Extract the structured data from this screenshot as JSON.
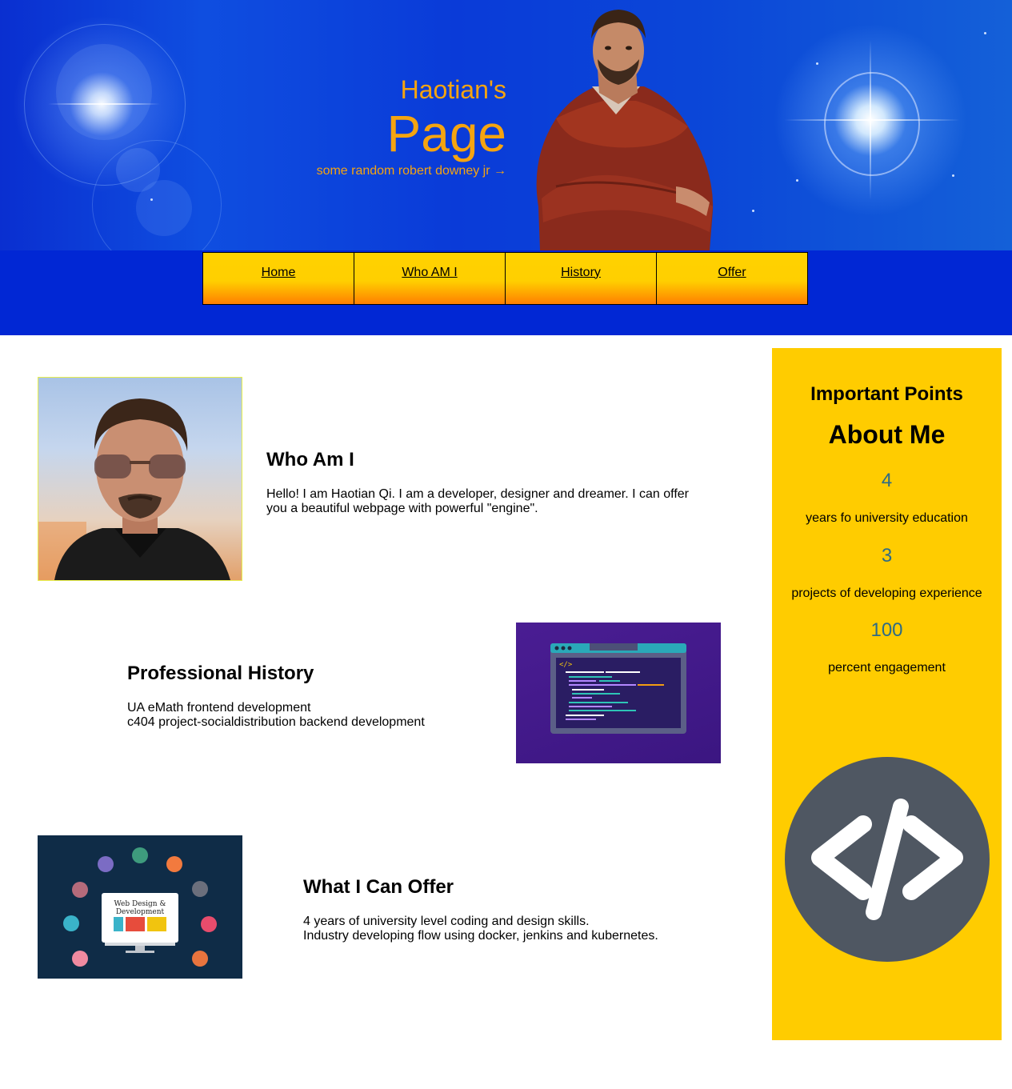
{
  "header": {
    "title_small": "Haotian's",
    "title_big": "Page",
    "subtitle": "some random robert downey jr →",
    "title_color": "#f5a410",
    "background": "#0127d4"
  },
  "nav": {
    "items": [
      {
        "label": "Home"
      },
      {
        "label": "Who AM I"
      },
      {
        "label": "History"
      },
      {
        "label": "Offer"
      }
    ]
  },
  "sections": {
    "who": {
      "title": "Who Am I",
      "text": "Hello! I am Haotian Qi. I am a developer, designer and dreamer. I can offer you a beautiful webpage with powerful \"engine\"."
    },
    "history": {
      "title": "Professional History",
      "lines": [
        "UA eMath frontend development",
        "c404 project-socialdistribution backend development"
      ]
    },
    "offer": {
      "title": "What I Can Offer",
      "lines": [
        "4 years of university level coding and design skills.",
        "Industry developing flow using docker, jenkins and kubernetes."
      ],
      "image_caption": [
        "Web Design &",
        "Development"
      ]
    }
  },
  "sidebar": {
    "subtitle": "Important Points",
    "title": "About Me",
    "stats": [
      {
        "value": "4",
        "label": "years fo university education"
      },
      {
        "value": "3",
        "label": "projects of developing experience"
      },
      {
        "value": "100",
        "label": "percent engagement"
      }
    ],
    "background": "#ffcc00",
    "number_color": "#2d6b86",
    "icon": "code-icon"
  }
}
